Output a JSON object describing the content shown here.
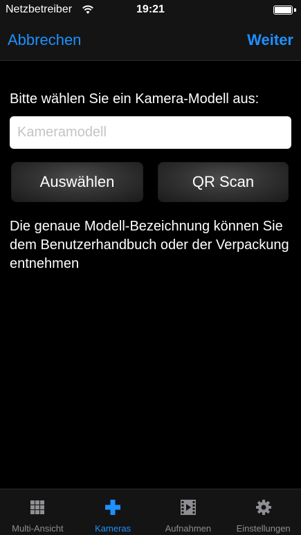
{
  "status_bar": {
    "carrier": "Netzbetreiber",
    "time": "19:21",
    "battery_level": 1.0
  },
  "nav": {
    "cancel_label": "Abbrechen",
    "next_label": "Weiter"
  },
  "form": {
    "prompt": "Bitte wählen Sie ein Kamera-Modell aus:",
    "model_placeholder": "Kameramodell",
    "model_value": "",
    "select_button": "Auswählen",
    "qr_button": "QR Scan",
    "hint": "Die genaue Modell-Bezeichnung können Sie dem Benutzerhandbuch oder der Verpackung entnehmen"
  },
  "tabs": [
    {
      "label": "Multi-Ansicht",
      "icon": "grid-icon",
      "active": false
    },
    {
      "label": "Kameras",
      "icon": "plus-icon",
      "active": true
    },
    {
      "label": "Aufnahmen",
      "icon": "film-icon",
      "active": false
    },
    {
      "label": "Einstellungen",
      "icon": "gear-icon",
      "active": false
    }
  ],
  "colors": {
    "accent": "#1e90ff",
    "bar_background": "#141414",
    "inactive_tab": "#8e8e93"
  }
}
